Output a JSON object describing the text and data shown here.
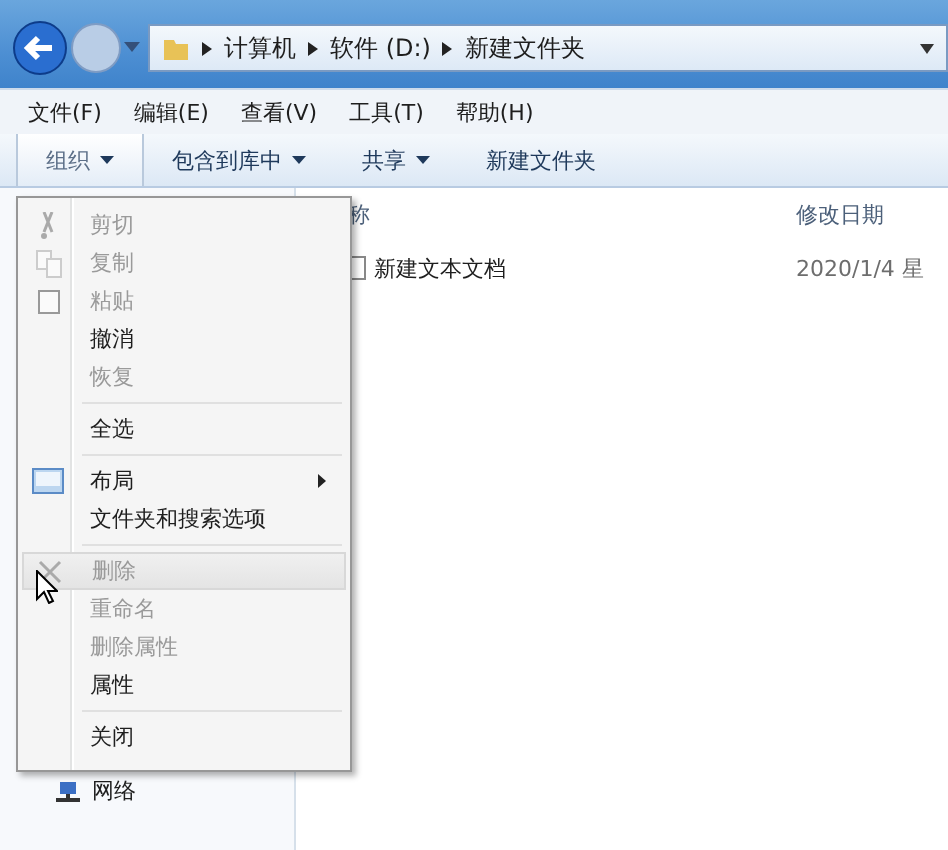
{
  "address_bar": {
    "crumbs": [
      "计算机",
      "软件 (D:)",
      "新建文件夹"
    ]
  },
  "menu_bar": [
    "文件(F)",
    "编辑(E)",
    "查看(V)",
    "工具(T)",
    "帮助(H)"
  ],
  "toolbar": [
    {
      "label": "组织",
      "dropdown": true,
      "selected": true
    },
    {
      "label": "包含到库中",
      "dropdown": true,
      "selected": false
    },
    {
      "label": "共享",
      "dropdown": true,
      "selected": false
    },
    {
      "label": "新建文件夹",
      "dropdown": false,
      "selected": false
    }
  ],
  "columns": [
    "称",
    "修改日期"
  ],
  "files": [
    {
      "name": "新建文本文档",
      "modified": "2020/1/4 星"
    }
  ],
  "nav": [
    {
      "label": "网络"
    }
  ],
  "organize_menu": [
    {
      "kind": "cut",
      "label": "剪切",
      "disabled": true,
      "highlighted": false,
      "submenu": false
    },
    {
      "kind": "copy",
      "label": "复制",
      "disabled": true,
      "highlighted": false,
      "submenu": false
    },
    {
      "kind": "paste",
      "label": "粘贴",
      "disabled": true,
      "highlighted": false,
      "submenu": false
    },
    {
      "kind": "item",
      "label": "撤消",
      "disabled": false,
      "highlighted": false,
      "submenu": false
    },
    {
      "kind": "item",
      "label": "恢复",
      "disabled": true,
      "highlighted": false,
      "submenu": false
    },
    {
      "kind": "separator"
    },
    {
      "kind": "item",
      "label": "全选",
      "disabled": false,
      "highlighted": false,
      "submenu": false
    },
    {
      "kind": "separator"
    },
    {
      "kind": "layout",
      "label": "布局",
      "disabled": false,
      "highlighted": false,
      "submenu": true
    },
    {
      "kind": "item",
      "label": "文件夹和搜索选项",
      "disabled": false,
      "highlighted": false,
      "submenu": false
    },
    {
      "kind": "separator"
    },
    {
      "kind": "delete",
      "label": "删除",
      "disabled": true,
      "highlighted": true,
      "submenu": false
    },
    {
      "kind": "item",
      "label": "重命名",
      "disabled": true,
      "highlighted": false,
      "submenu": false
    },
    {
      "kind": "item",
      "label": "删除属性",
      "disabled": true,
      "highlighted": false,
      "submenu": false
    },
    {
      "kind": "item",
      "label": "属性",
      "disabled": false,
      "highlighted": false,
      "submenu": false
    },
    {
      "kind": "separator"
    },
    {
      "kind": "item",
      "label": "关闭",
      "disabled": false,
      "highlighted": false,
      "submenu": false
    }
  ]
}
